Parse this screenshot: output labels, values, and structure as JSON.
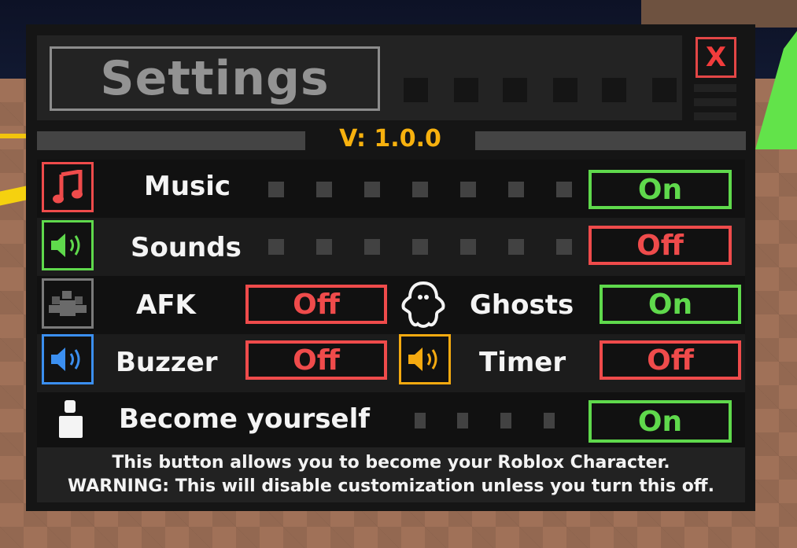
{
  "window": {
    "title": "Settings",
    "close_label": "X",
    "version": "V: 1.0.0"
  },
  "colors": {
    "on": "#5fd94c",
    "off": "#ef4b4b",
    "version": "#f7b10e",
    "music_icon": "#ef4b4b",
    "sounds_icon": "#5fd94c",
    "afk_icon": "#7a7a7a",
    "buzzer_icon": "#3b8ff0",
    "timer_icon": "#f5aa10"
  },
  "settings": {
    "music": {
      "label": "Music",
      "icon": "music-note-icon",
      "state": "On"
    },
    "sounds": {
      "label": "Sounds",
      "icon": "speaker-icon",
      "state": "Off"
    },
    "afk": {
      "label": "AFK",
      "icon": "afk-icon",
      "state": "Off"
    },
    "ghosts": {
      "label": "Ghosts",
      "icon": "ghost-icon",
      "state": "On"
    },
    "buzzer": {
      "label": "Buzzer",
      "icon": "speaker-icon",
      "state": "Off"
    },
    "timer": {
      "label": "Timer",
      "icon": "speaker-icon",
      "state": "Off"
    },
    "become_yourself": {
      "label": "Become yourself",
      "icon": "character-icon",
      "state": "On"
    }
  },
  "description": {
    "line1": "This button allows you to become your Roblox Character.",
    "line2": "WARNING: This will disable customization unless you turn this off."
  }
}
